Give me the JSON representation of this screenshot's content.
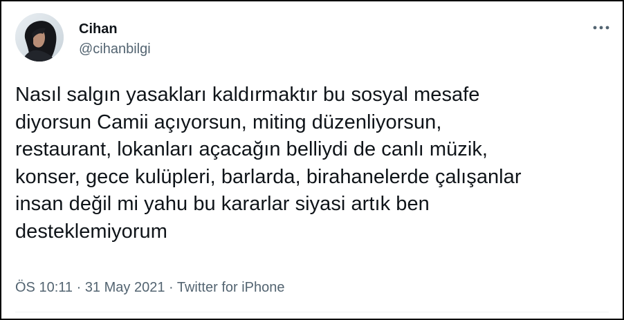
{
  "author": {
    "name": "Cihan",
    "handle": "@cihanbilgi"
  },
  "icons": {
    "avatar": "profile-photo",
    "more": "more-horizontal-icon"
  },
  "tweet": {
    "text": "Nasıl salgın yasakları kaldırmaktır bu sosyal mesafe\ndiyorsun Camii açıyorsun, miting düzenliyorsun,\nrestaurant, lokanları açacağın belliydi de canlı müzik,\nkonser, gece kulüpleri, barlarda, birahanelerde çalışanlar\ninsan değil mi yahu bu kararlar siyasi artık ben\ndesteklemiyorum"
  },
  "meta": {
    "time": "ÖS 10:11",
    "separator1": " · ",
    "date": "31 May 2021",
    "separator2": " · ",
    "source": "Twitter for iPhone"
  },
  "colors": {
    "text_primary": "#0f1419",
    "text_secondary": "#536471",
    "frame_border": "#000000"
  }
}
